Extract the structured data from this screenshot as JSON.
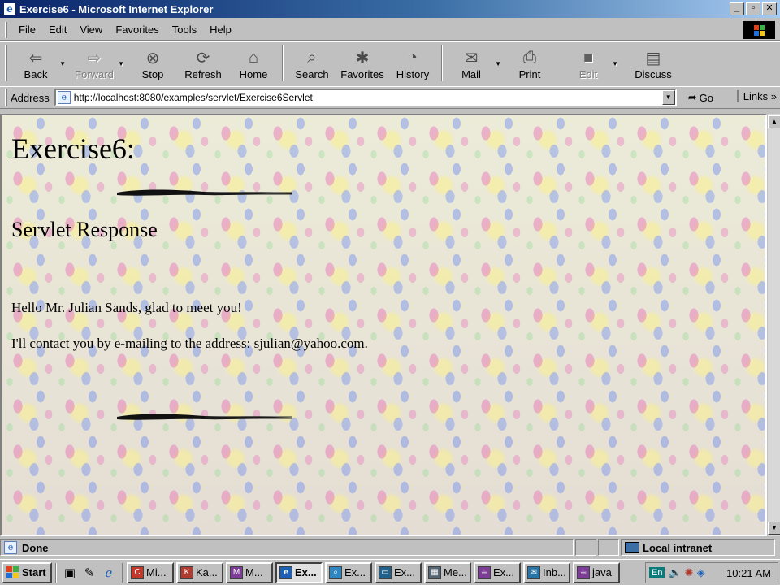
{
  "window": {
    "title": "Exercise6 - Microsoft Internet Explorer",
    "buttons": [
      "_",
      "▫",
      "✕"
    ]
  },
  "menubar": {
    "items": [
      {
        "label": "File"
      },
      {
        "label": "Edit"
      },
      {
        "label": "View"
      },
      {
        "label": "Favorites"
      },
      {
        "label": "Tools"
      },
      {
        "label": "Help"
      }
    ]
  },
  "toolbar": {
    "buttons": [
      {
        "label": "Back",
        "icon": "back-arrow-icon",
        "glyph": "⇦"
      },
      {
        "label": "Forward",
        "icon": "forward-arrow-icon",
        "glyph": "⇨"
      },
      {
        "label": "Stop",
        "icon": "stop-icon",
        "glyph": "⊗"
      },
      {
        "label": "Refresh",
        "icon": "refresh-icon",
        "glyph": "⟳"
      },
      {
        "label": "Home",
        "icon": "home-icon",
        "glyph": "⌂"
      },
      {
        "label": "Search",
        "icon": "search-icon",
        "glyph": "⌕"
      },
      {
        "label": "Favorites",
        "icon": "favorites-icon",
        "glyph": "✱"
      },
      {
        "label": "History",
        "icon": "history-icon",
        "glyph": "◔"
      },
      {
        "label": "Mail",
        "icon": "mail-icon",
        "glyph": "✉"
      },
      {
        "label": "Print",
        "icon": "print-icon",
        "glyph": "⎙"
      },
      {
        "label": "Edit",
        "icon": "edit-icon",
        "glyph": "■"
      },
      {
        "label": "Discuss",
        "icon": "discuss-icon",
        "glyph": "▤"
      }
    ]
  },
  "address": {
    "label": "Address",
    "url": "http://localhost:8080/examples/servlet/Exercise6Servlet",
    "go_label": "Go",
    "links_label": "Links"
  },
  "page": {
    "heading": "Exercise6:",
    "subheading": "Servlet Response",
    "greeting": "Hello  Mr. Julian Sands, glad to meet you!",
    "contact": "I'll contact you by e-mailing to the address:  sjulian@yahoo.com."
  },
  "status": {
    "text": "Done",
    "zone": "Local intranet"
  },
  "taskbar": {
    "start_label": "Start",
    "tasks": [
      {
        "label": "Mi...",
        "color": "#c0392b"
      },
      {
        "label": "Ka...",
        "color": "#b03a2e"
      },
      {
        "label": "M...",
        "color": "#7d3c98"
      },
      {
        "label": "Ex...",
        "color": "#1b5fb8"
      },
      {
        "label": "Ex...",
        "color": "#2e86c1"
      },
      {
        "label": "Ex...",
        "color": "#1f618d"
      },
      {
        "label": "Me...",
        "color": "#566573"
      },
      {
        "label": "Ex...",
        "color": "#7d3c98"
      },
      {
        "label": "Inb...",
        "color": "#2874a6"
      },
      {
        "label": "java",
        "color": "#7d3c98"
      }
    ],
    "lang": "En",
    "clock": "10:21 AM"
  }
}
